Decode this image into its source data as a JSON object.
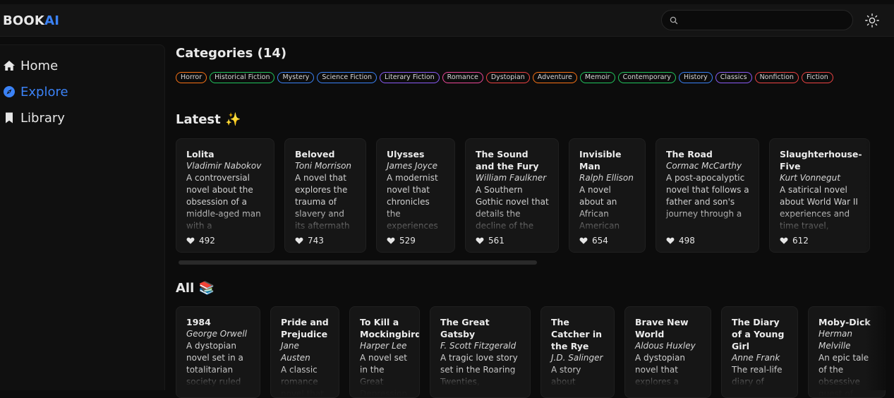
{
  "header": {
    "logo_prefix": "BOOK",
    "logo_suffix": "AI",
    "search_placeholder": "",
    "theme_icon": "sun-icon"
  },
  "sidebar": {
    "items": [
      {
        "label": "Home",
        "icon": "home-icon"
      },
      {
        "label": "Explore",
        "icon": "compass-icon",
        "active": true
      },
      {
        "label": "Library",
        "icon": "bookmark-icon"
      }
    ]
  },
  "categories": {
    "title": "Categories (14)",
    "tags": [
      {
        "label": "Horror",
        "color": "#f97316"
      },
      {
        "label": "Historical Fiction",
        "color": "#22c55e"
      },
      {
        "label": "Mystery",
        "color": "#3b82f6"
      },
      {
        "label": "Science Fiction",
        "color": "#3b82f6"
      },
      {
        "label": "Literary Fiction",
        "color": "#8b5cf6"
      },
      {
        "label": "Romance",
        "color": "#ec4899"
      },
      {
        "label": "Dystopian",
        "color": "#ef4444"
      },
      {
        "label": "Adventure",
        "color": "#f97316"
      },
      {
        "label": "Memoir",
        "color": "#22c55e"
      },
      {
        "label": "Contemporary",
        "color": "#22c55e"
      },
      {
        "label": "History",
        "color": "#3b82f6"
      },
      {
        "label": "Classics",
        "color": "#8b5cf6"
      },
      {
        "label": "Nonfiction",
        "color": "#ef4444"
      },
      {
        "label": "Fiction",
        "color": "#ef4444"
      }
    ]
  },
  "latest": {
    "title": "Latest ✨",
    "books": [
      {
        "title": "Lolita",
        "author": "Vladimir Nabokov",
        "description": "A controversial novel about the obsession of a middle-aged man with a",
        "likes": "492"
      },
      {
        "title": "Beloved",
        "author": "Toni Morrison",
        "description": "A novel that explores the trauma of slavery and its aftermath",
        "likes": "743"
      },
      {
        "title": "Ulysses",
        "author": "James Joyce",
        "description": "A modernist novel that chronicles the experiences",
        "likes": "529"
      },
      {
        "title": "The Sound and the Fury",
        "author": "William Faulkner",
        "description": "A Southern Gothic novel that details the decline of the",
        "likes": "561"
      },
      {
        "title": "Invisible Man",
        "author": "Ralph Ellison",
        "description": "A novel about an African American",
        "likes": "654"
      },
      {
        "title": "The Road",
        "author": "Cormac McCarthy",
        "description": "A post-apocalyptic novel that follows a father and son's journey through a",
        "likes": "498"
      },
      {
        "title": "Slaughterhouse-Five",
        "author": "Kurt Vonnegut",
        "description": "A satirical novel about World War II experiences and time travel,",
        "likes": "612"
      }
    ]
  },
  "all": {
    "title": "All 📚",
    "books": [
      {
        "title": "1984",
        "author": "George Orwell",
        "description": "A dystopian novel set in a totalitarian society ruled"
      },
      {
        "title": "Pride and Prejudice",
        "author": "Jane Austen",
        "description": "A classic romance novel that"
      },
      {
        "title": "To Kill a Mockingbird",
        "author": "Harper Lee",
        "description": "A novel set in the Great Depression,"
      },
      {
        "title": "The Great Gatsby",
        "author": "F. Scott Fitzgerald",
        "description": "A tragic love story set in the Roaring Twenties,"
      },
      {
        "title": "The Catcher in the Rye",
        "author": "J.D. Salinger",
        "description": "A story about"
      },
      {
        "title": "Brave New World",
        "author": "Aldous Huxley",
        "description": "A dystopian novel that explores a"
      },
      {
        "title": "The Diary of a Young Girl",
        "author": "Anne Frank",
        "description": "The real-life diary of"
      },
      {
        "title": "Moby-Dick",
        "author": "Herman Melville",
        "description": "An epic tale of the obsessive quest of Captain Ahab"
      }
    ]
  }
}
